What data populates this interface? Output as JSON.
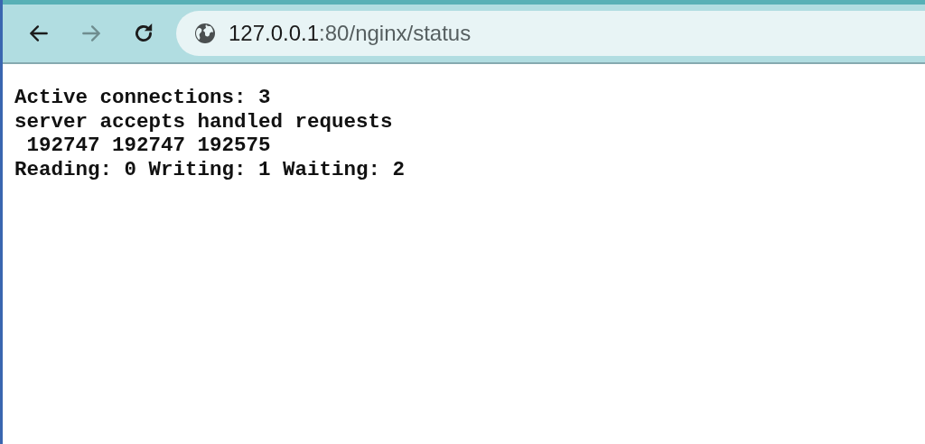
{
  "toolbar": {
    "back": {
      "disabled": false
    },
    "forward": {
      "disabled": true
    },
    "address": {
      "host": "127.0.0.1",
      "path": ":80/nginx/status"
    }
  },
  "page": {
    "lines": [
      "Active connections: 3",
      "server accepts handled requests",
      " 192747 192747 192575",
      "Reading: 0 Writing: 1 Waiting: 2"
    ]
  }
}
